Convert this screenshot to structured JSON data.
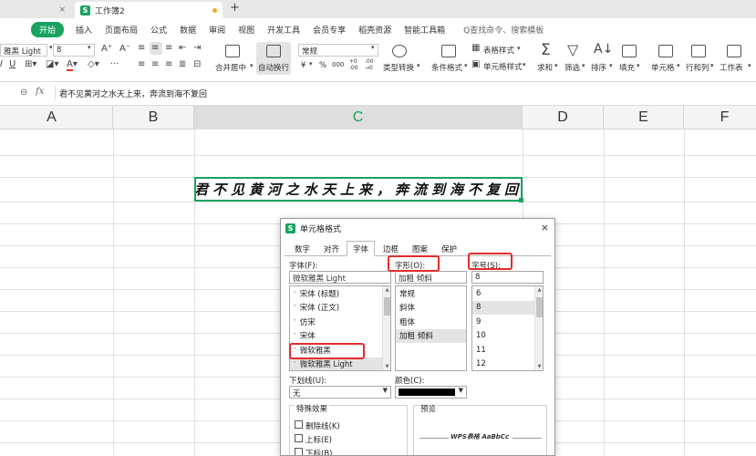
{
  "titlebar": {
    "inactive_tab_close": "×",
    "active_tab_title": "工作簿2",
    "new_tab": "+"
  },
  "menu": {
    "start": "开始",
    "items": [
      "插入",
      "页面布局",
      "公式",
      "数据",
      "审阅",
      "视图",
      "开发工具",
      "会员专享",
      "稻壳资源",
      "智能工具箱"
    ],
    "search": "Q查找命令、搜索模板"
  },
  "toolbar": {
    "font_name": "雅黑 Light",
    "font_size": "8",
    "merge_center": "合并居中",
    "wrap_text": "自动换行",
    "number_format": "常规",
    "currency": "¥",
    "percent": "%",
    "thousands": "000",
    "decimal_inc": "+0 .00",
    "decimal_dec": ".00 →0",
    "type_convert": "类型转换",
    "conditional_format": "条件格式",
    "table_style": "表格样式",
    "cell_style": "单元格样式",
    "sum": "求和",
    "filter": "筛选",
    "sort": "排序",
    "fill": "填充",
    "cell": "单元格",
    "row_col": "行和列",
    "worksheet": "工作表"
  },
  "formula_bar": {
    "fx": "fx",
    "content": "君不见黄河之水天上来，奔流到海不复回"
  },
  "grid": {
    "columns": [
      "A",
      "B",
      "C",
      "D",
      "E",
      "F"
    ],
    "active_column": "C",
    "cell_text": "君不见黄河之水天上来，奔流到海不复回"
  },
  "dialog": {
    "title": "单元格格式",
    "close": "×",
    "tabs": [
      "数字",
      "对齐",
      "字体",
      "边框",
      "图案",
      "保护"
    ],
    "active_tab": "字体",
    "font_label": "字体(F):",
    "font_value": "微软雅黑 Light",
    "font_list": [
      "宋体 (标题)",
      "宋体 (正文)",
      "仿宋",
      "宋体",
      "微软雅黑",
      "微软雅黑 Light"
    ],
    "style_label": "字形(O):",
    "style_value": "加粗 倾斜",
    "style_list": [
      "常规",
      "斜体",
      "粗体",
      "加粗 倾斜"
    ],
    "size_label": "字号(S):",
    "size_value": "8",
    "size_list": [
      "6",
      "8",
      "9",
      "10",
      "11",
      "12"
    ],
    "underline_label": "下划线(U):",
    "underline_value": "无",
    "color_label": "颜色(C):",
    "color_value": "#000000",
    "effects_label": "特殊效果",
    "effects": [
      "删除线(K)",
      "上标(E)",
      "下标(B)"
    ],
    "preview_label": "预览",
    "preview_text": "WPS表格  AaBbCc",
    "highlight_color": "#e32b2b"
  },
  "colors": {
    "accent": "#1aa260",
    "active_tab_dot": "#f5a623"
  }
}
